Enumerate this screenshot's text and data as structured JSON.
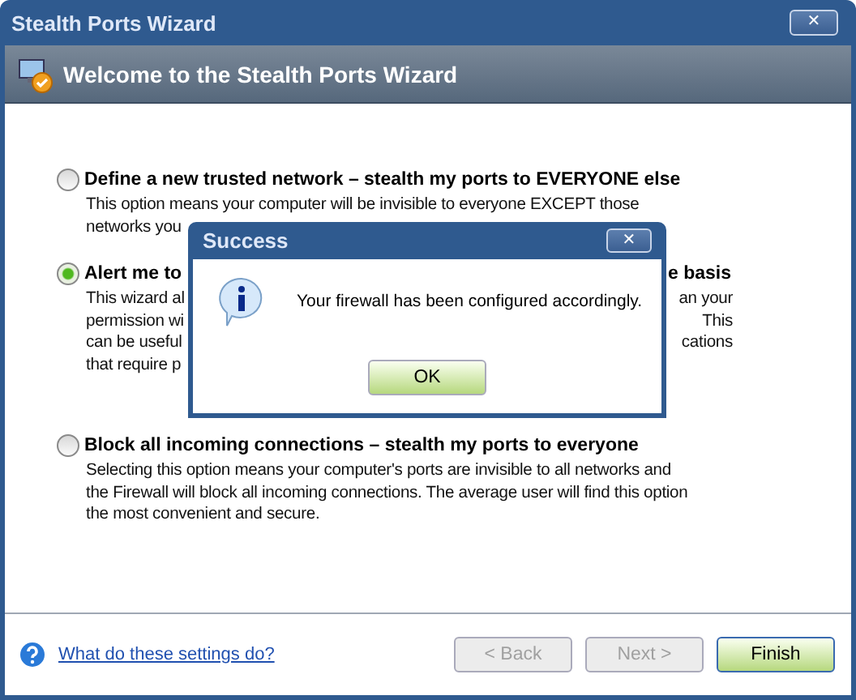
{
  "window": {
    "title": "Stealth Ports Wizard",
    "close": "✕"
  },
  "header": {
    "title": "Welcome to the Stealth Ports Wizard"
  },
  "options": [
    {
      "selected": false,
      "heading": [
        "Define a new trusted network – stealth my ports to EVERYONE else"
      ],
      "lines": [
        [
          "This option means your computer will be invisible to everyone EXCEPT those"
        ],
        [
          "networks you"
        ]
      ]
    },
    {
      "selected": true,
      "heading": [
        "Alert me to",
        "e basis"
      ],
      "lines": [
        [
          "This wizard al",
          "an your"
        ],
        [
          "permission wi",
          "This"
        ],
        [
          "can be useful",
          "cations"
        ],
        [
          "that require p"
        ]
      ]
    },
    {
      "selected": false,
      "heading": [
        "Block all incoming connections – stealth my ports to everyone"
      ],
      "lines": [
        [
          "Selecting this option means your computer's ports are invisible to all networks and"
        ],
        [
          "the Firewall will block all incoming connections. The average user will find this option"
        ],
        [
          "the most convenient and secure."
        ]
      ]
    }
  ],
  "help_link": "What do these settings do?",
  "buttons": [
    {
      "label": "< Back",
      "disabled": true,
      "primary": false
    },
    {
      "label": "Next >",
      "disabled": true,
      "primary": false
    },
    {
      "label": "Finish",
      "disabled": false,
      "primary": true
    }
  ],
  "dialog": {
    "title": "Success",
    "close": "✕",
    "message": "Your firewall has been configured accordingly.",
    "button": "OK"
  }
}
